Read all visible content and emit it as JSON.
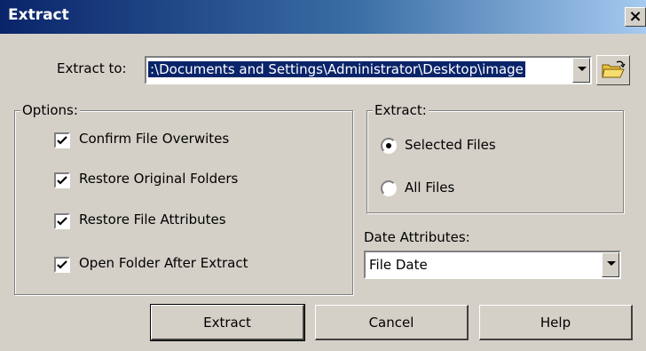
{
  "window": {
    "title": "Extract",
    "close_glyph": "×"
  },
  "extract_to": {
    "label": "Extract to:",
    "value": ":\\Documents and Settings\\Administrator\\Desktop\\image"
  },
  "options": {
    "legend": "Options:",
    "items": [
      {
        "label": "Confirm File Overwites",
        "checked": true
      },
      {
        "label": "Restore Original Folders",
        "checked": true
      },
      {
        "label": "Restore File Attributes",
        "checked": true
      },
      {
        "label": "Open Folder After Extract",
        "checked": true
      }
    ]
  },
  "extract": {
    "legend": "Extract:",
    "choices": [
      {
        "label": "Selected Files",
        "selected": true
      },
      {
        "label": "All Files",
        "selected": false
      }
    ]
  },
  "date_attributes": {
    "label": "Date Attributes:",
    "value": "File Date"
  },
  "buttons": {
    "extract": "Extract",
    "cancel": "Cancel",
    "help": "Help"
  },
  "icons": {
    "browse": "open-folder-icon",
    "dropdown": "chevron-down-icon",
    "check": "checkmark-icon"
  }
}
